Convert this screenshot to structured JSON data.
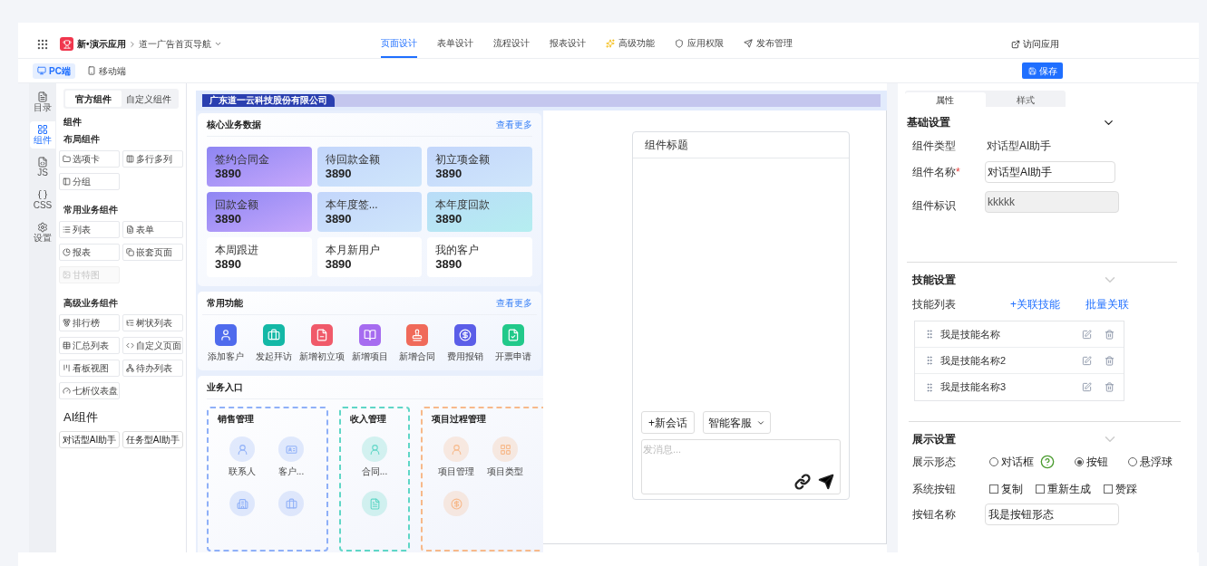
{
  "header": {
    "app_name": "新•演示应用",
    "breadcrumb": "道一广告首页导航",
    "nav": [
      {
        "label": "页面设计",
        "selected": true
      },
      {
        "label": "表单设计",
        "selected": false
      },
      {
        "label": "流程设计",
        "selected": false
      },
      {
        "label": "报表设计",
        "selected": false
      },
      {
        "label": "高级功能",
        "selected": false
      },
      {
        "label": "应用权限",
        "selected": false
      },
      {
        "label": "发布管理",
        "selected": false
      }
    ],
    "visit": "访问应用"
  },
  "toolbar": {
    "devices": [
      {
        "label": "PC端",
        "selected": true
      },
      {
        "label": "移动端",
        "selected": false
      }
    ],
    "save": "保存"
  },
  "rail": [
    {
      "label": "目录",
      "selected": false
    },
    {
      "label": "组件",
      "selected": true
    },
    {
      "label": "JS",
      "selected": false
    },
    {
      "label": "CSS",
      "selected": false
    },
    {
      "label": "设置",
      "selected": false
    }
  ],
  "components": {
    "tabs": [
      {
        "label": "官方组件",
        "selected": true
      },
      {
        "label": "自定义组件",
        "selected": false
      }
    ],
    "title": "组件",
    "groups": [
      {
        "title": "布局组件",
        "items": [
          {
            "label": "选项卡",
            "disabled": false
          },
          {
            "label": "多行多列",
            "disabled": false
          },
          {
            "label": "分组",
            "disabled": false
          }
        ]
      },
      {
        "title": "常用业务组件",
        "items": [
          {
            "label": "列表",
            "disabled": false
          },
          {
            "label": "表单",
            "disabled": false
          },
          {
            "label": "报表",
            "disabled": false
          },
          {
            "label": "嵌套页面",
            "disabled": false
          },
          {
            "label": "甘特图",
            "disabled": true
          }
        ]
      },
      {
        "title": "高级业务组件",
        "items": [
          {
            "label": "排行榜",
            "disabled": false
          },
          {
            "label": "树状列表",
            "disabled": false
          },
          {
            "label": "汇总列表",
            "disabled": false
          },
          {
            "label": "自定义页面",
            "disabled": false
          },
          {
            "label": "看板视图",
            "disabled": false
          },
          {
            "label": "待办列表",
            "disabled": false
          },
          {
            "label": "七析仪表盘",
            "disabled": false
          }
        ]
      }
    ],
    "ai": {
      "title": "AI组件",
      "items": [
        "对话型AI助手",
        "任务型AI助手"
      ]
    }
  },
  "canvas": {
    "banner": "广东道一云科技股份有限公司",
    "core": {
      "title": "核心业务数据",
      "more": "查看更多",
      "cards": [
        {
          "label": "签约合同金",
          "value": "3890",
          "kind": "purple"
        },
        {
          "label": "待回款金额",
          "value": "3890",
          "kind": "blue"
        },
        {
          "label": "初立项金额",
          "value": "3890",
          "kind": "blue"
        },
        {
          "label": "回款金额",
          "value": "3890",
          "kind": "purple"
        },
        {
          "label": "本年度签...",
          "value": "3890",
          "kind": "blue"
        },
        {
          "label": "本年度回款",
          "value": "3890",
          "kind": "teal"
        },
        {
          "label": "本周跟进",
          "value": "3890",
          "kind": "white"
        },
        {
          "label": "本月新用户",
          "value": "3890",
          "kind": "white"
        },
        {
          "label": "我的客户",
          "value": "3890",
          "kind": "white"
        }
      ]
    },
    "common": {
      "title": "常用功能",
      "more": "查看更多",
      "items": [
        {
          "label": "添加客户",
          "color": "#4f6bed"
        },
        {
          "label": "发起拜访",
          "color": "#14b8a6"
        },
        {
          "label": "新增初立项",
          "color": "#f05a6a"
        },
        {
          "label": "新增项目",
          "color": "#a66cf0"
        },
        {
          "label": "新增合同",
          "color": "#f06a5a"
        },
        {
          "label": "费用报销",
          "color": "#5b5ee8"
        },
        {
          "label": "开票申请",
          "color": "#22c98a"
        }
      ]
    },
    "business": {
      "title": "业务入口",
      "groups": [
        {
          "title": "销售管理",
          "color": "#8fb0f8",
          "items": [
            {
              "label": "联系人",
              "kind": "labelled"
            },
            {
              "label": "客户...",
              "kind": "labelled"
            },
            {
              "kind": "icon_only"
            },
            {
              "kind": "icon_only"
            }
          ]
        },
        {
          "title": "收入管理",
          "color": "#5fd6c6",
          "items": [
            {
              "label": "合同...",
              "kind": "labelled"
            },
            {
              "kind": "icon_only"
            }
          ]
        },
        {
          "title": "项目过程管理",
          "color": "#f7b98a",
          "items": [
            {
              "label": "项目管理",
              "kind": "labelled"
            },
            {
              "label": "项目类型",
              "kind": "labelled"
            },
            {
              "kind": "icon_only"
            }
          ]
        }
      ]
    },
    "chat": {
      "title": "组件标题",
      "new_chat": "+新会话",
      "agent": "智能客服",
      "placeholder": "发消息..."
    }
  },
  "properties": {
    "tabs": [
      {
        "label": "属性",
        "selected": true
      },
      {
        "label": "样式",
        "selected": false
      }
    ],
    "basic": {
      "title": "基础设置",
      "type_label": "组件类型",
      "type_value": "对话型AI助手",
      "name_label": "组件名称",
      "required_mark": "*",
      "name_value": "对话型AI助手",
      "id_label": "组件标识",
      "id_value": "kkkkk"
    },
    "skills": {
      "title": "技能设置",
      "list_label": "技能列表",
      "link": "+关联技能",
      "batch": "批量关联",
      "items": [
        {
          "name": "我是技能名称"
        },
        {
          "name": "我是技能名称2"
        },
        {
          "name": "我是技能名称3"
        }
      ]
    },
    "display": {
      "title": "展示设置",
      "mode_label": "展示形态",
      "modes": [
        {
          "label": "对话框",
          "selected": false,
          "help": true
        },
        {
          "label": "按钮",
          "selected": true,
          "help": false
        },
        {
          "label": "悬浮球",
          "selected": false,
          "help": false
        }
      ],
      "system_label": "系统按钮",
      "system_buttons": [
        {
          "label": "复制",
          "checked": false
        },
        {
          "label": "重新生成",
          "checked": false
        },
        {
          "label": "赞踩",
          "checked": false
        }
      ],
      "button_name_label": "按钮名称",
      "button_name_value": "我是按钮形态"
    }
  }
}
